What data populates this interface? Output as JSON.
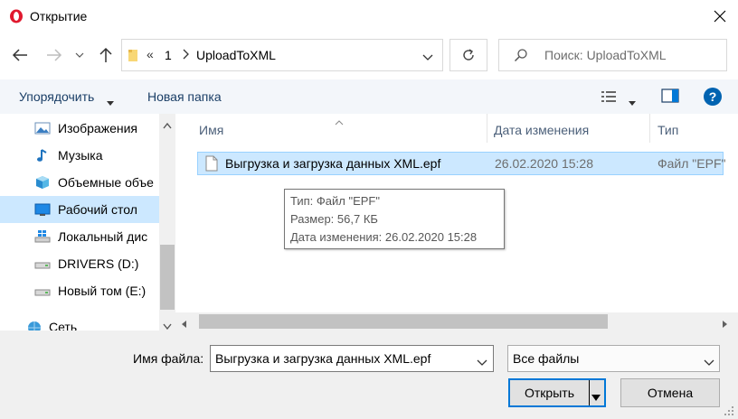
{
  "window": {
    "title": "Открытие",
    "close_glyph": "✕"
  },
  "address": {
    "overflow": "«",
    "crumbs": [
      "1",
      "UploadToXML"
    ]
  },
  "search": {
    "placeholder": "Поиск: UploadToXML"
  },
  "toolbar": {
    "organize_label": "Упорядочить",
    "new_folder_label": "Новая папка"
  },
  "sidebar": {
    "items": [
      {
        "label": "Изображения",
        "icon": "images-icon"
      },
      {
        "label": "Музыка",
        "icon": "music-icon"
      },
      {
        "label": "Объемные объе",
        "icon": "3d-objects-icon"
      },
      {
        "label": "Рабочий стол",
        "icon": "desktop-icon",
        "selected": true
      },
      {
        "label": "Локальный дис",
        "icon": "windows-drive-icon"
      },
      {
        "label": "DRIVERS (D:)",
        "icon": "drive-icon"
      },
      {
        "label": "Новый том (E:)",
        "icon": "drive-icon"
      },
      {
        "label": "Сеть",
        "icon": "network-icon"
      }
    ]
  },
  "columns": {
    "name": "Имя",
    "date": "Дата изменения",
    "type": "Тип"
  },
  "files": [
    {
      "name": "Выгрузка и загрузка данных XML.epf",
      "date": "26.02.2020 15:28",
      "type": "Файл \"EPF\""
    }
  ],
  "tooltip": {
    "type_line": "Тип: Файл \"EPF\"",
    "size_line": "Размер: 56,7 КБ",
    "date_line": "Дата изменения: 26.02.2020 15:28"
  },
  "bottom": {
    "filename_label": "Имя файла:",
    "filename_value": "Выгрузка и загрузка данных XML.epf",
    "filter_value": "Все файлы",
    "open_label": "Открыть",
    "cancel_label": "Отмена"
  },
  "colors": {
    "accent": "#0078d7",
    "selection": "#cce8ff",
    "toolbar_bg": "#f3f6fa",
    "opera_red": "#e0192e"
  }
}
